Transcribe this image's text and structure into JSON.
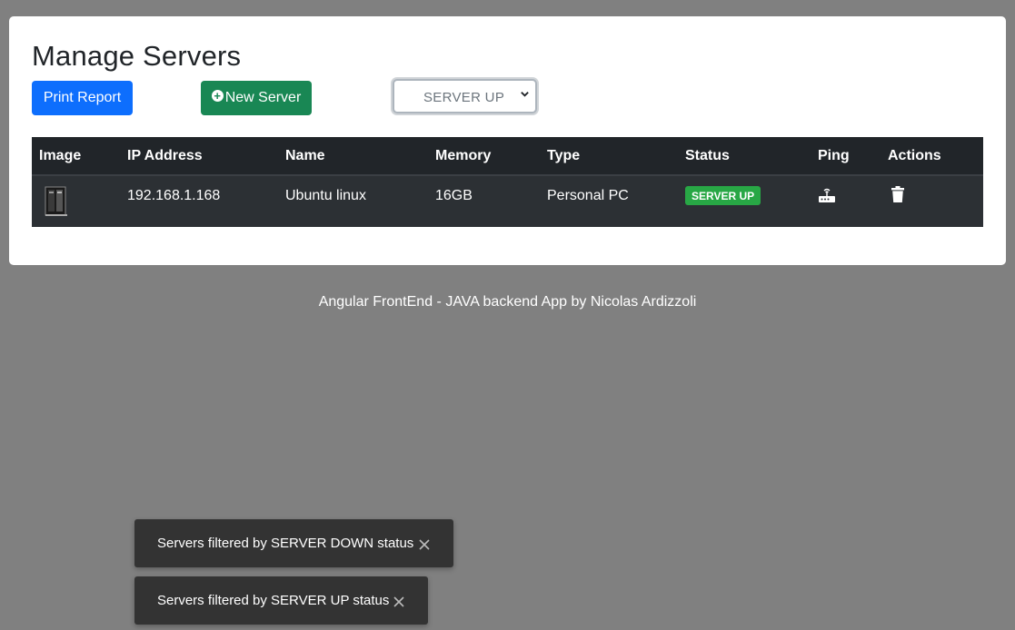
{
  "header": {
    "title": "Manage Servers",
    "print_button": "Print Report",
    "new_server_button": "New Server",
    "filter_select": {
      "value": "SERVER UP"
    }
  },
  "table": {
    "headers": [
      "Image",
      "IP Address",
      "Name",
      "Memory",
      "Type",
      "Status",
      "Ping",
      "Actions"
    ],
    "rows": [
      {
        "ip": "192.168.1.168",
        "name": "Ubuntu linux",
        "memory": "16GB",
        "type": "Personal PC",
        "status": "SERVER UP"
      }
    ]
  },
  "footer": "Angular FrontEnd - JAVA backend App by Nicolas Ardizzoli",
  "toasts": [
    {
      "message": "Servers filtered by SERVER DOWN status"
    },
    {
      "message": "Servers filtered by SERVER UP status"
    }
  ],
  "colors": {
    "background": "#808080",
    "primary": "#0d6efd",
    "success": "#198754",
    "badge_up": "#28a745",
    "table_dark": "#212529",
    "toast": "#333333"
  },
  "icons": {
    "new_server": "plus-circle-icon",
    "select": "chevron-down-icon",
    "image": "server-image",
    "ping": "router-icon",
    "actions": "trash-icon",
    "toast_close": "close-icon"
  }
}
